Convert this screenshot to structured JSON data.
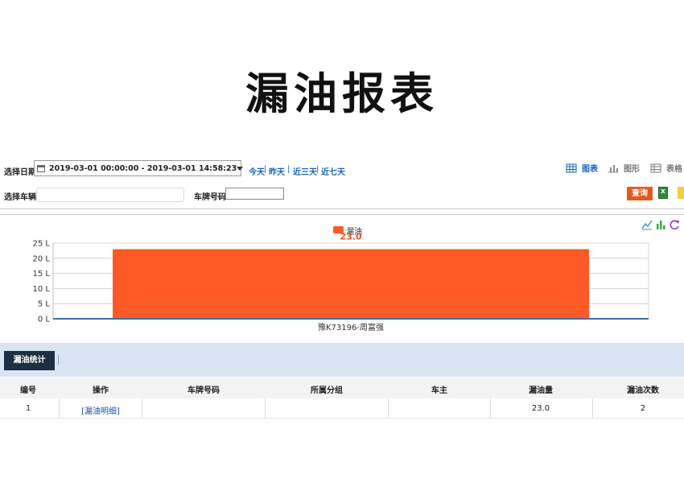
{
  "page": {
    "title": "漏油报表"
  },
  "filters": {
    "date_label": "选择日期",
    "date_range": "2019-03-01 00:00:00 - 2019-03-01 14:58:23",
    "quick": [
      "今天",
      "昨天",
      "近三天",
      "近七天"
    ],
    "vehicle_label": "选择车辆",
    "vehicle_value": "",
    "plate_label": "车牌号码",
    "plate_value": ""
  },
  "views": {
    "table_chart": "图表",
    "graph": "图形",
    "table": "表格"
  },
  "actions": {
    "query": "查询"
  },
  "chart_data": {
    "type": "bar",
    "categories": [
      "豫K73196-周富强"
    ],
    "series": [
      {
        "name": "漏油",
        "values": [
          23.0
        ],
        "color": "#fb5a26"
      }
    ],
    "data_labels": [
      "23.0"
    ],
    "yticks": [
      "0 L",
      "5 L",
      "10 L",
      "15 L",
      "20 L",
      "25 L"
    ],
    "ylim": [
      0,
      25
    ],
    "grid": true,
    "legend": "top-center"
  },
  "tabs": {
    "leak_stats": "漏油统计"
  },
  "table": {
    "columns": [
      "编号",
      "操作",
      "车牌号码",
      "所属分组",
      "车主",
      "漏油量",
      "漏油次数"
    ],
    "rows": [
      {
        "no": "1",
        "action": "[漏油明细]",
        "plate": "",
        "group": "",
        "owner": "",
        "amount": "23.0",
        "count": "2"
      }
    ]
  },
  "colors": {
    "accent": "#e8581b",
    "link": "#1a63b8",
    "tab_dark": "#1d2f43",
    "tab_bar": "#d9e5f2"
  }
}
